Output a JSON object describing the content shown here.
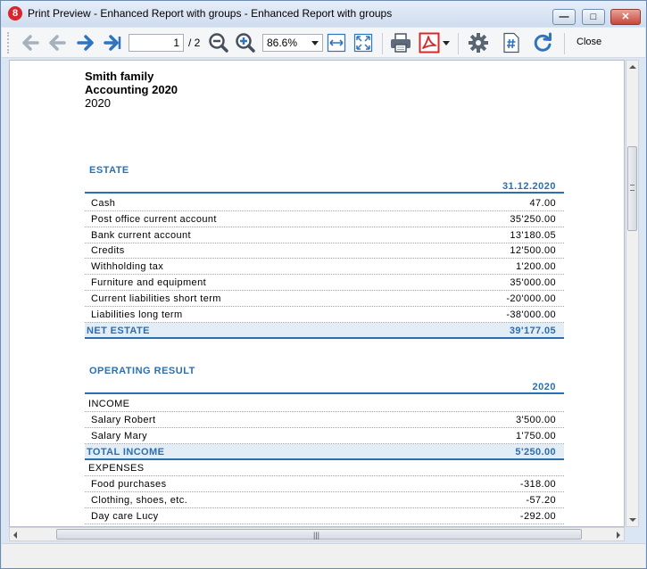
{
  "window": {
    "title": "Print Preview - Enhanced Report with groups - Enhanced Report with groups",
    "app_icon_letter": "8",
    "min_glyph": "—",
    "max_glyph": "□",
    "close_glyph": "✕"
  },
  "toolbar": {
    "page_value": "1",
    "page_total": "/ 2",
    "zoom_value": "86.6%",
    "close_label": "Close",
    "icons": [
      "back-disabled",
      "back-disabled",
      "forward",
      "last-page",
      "zoom-out",
      "zoom-in",
      "fit-width",
      "fit-page",
      "print",
      "pdf",
      "settings",
      "page-number",
      "refresh"
    ]
  },
  "report": {
    "head1": "Smith family",
    "head2": "Accounting 2020",
    "head3": "2020",
    "estate": {
      "title": "ESTATE",
      "column": "31.12.2020",
      "rows": [
        {
          "label": "Cash",
          "value": "47.00"
        },
        {
          "label": "Post office current account",
          "value": "35'250.00"
        },
        {
          "label": "Bank current account",
          "value": "13'180.05"
        },
        {
          "label": "Credits",
          "value": "12'500.00"
        },
        {
          "label": "Withholding tax",
          "value": "1'200.00"
        },
        {
          "label": "Furniture and equipment",
          "value": "35'000.00"
        },
        {
          "label": "Current liabilities short term",
          "value": "-20'000.00"
        },
        {
          "label": "Liabilities long term",
          "value": "-38'000.00"
        }
      ],
      "total_label": "NET ESTATE",
      "total_value": "39'177.05"
    },
    "operating": {
      "title": "OPERATING RESULT",
      "column": "2020",
      "income_label": "INCOME",
      "income_rows": [
        {
          "label": "Salary Robert",
          "value": "3'500.00"
        },
        {
          "label": "Salary Mary",
          "value": "1'750.00"
        }
      ],
      "income_total_label": "TOTAL INCOME",
      "income_total_value": "5'250.00",
      "expenses_label": "EXPENSES",
      "expense_rows": [
        {
          "label": "Food purchases",
          "value": "-318.00"
        },
        {
          "label": "Clothing, shoes, etc.",
          "value": "-57.20"
        },
        {
          "label": "Day care Lucy",
          "value": "-292.00"
        }
      ]
    }
  },
  "colors": {
    "accent": "#2a6fb2",
    "total_bg": "#e3edf6",
    "pdf_red": "#d62a2a",
    "nav_blue": "#2f74c0"
  }
}
